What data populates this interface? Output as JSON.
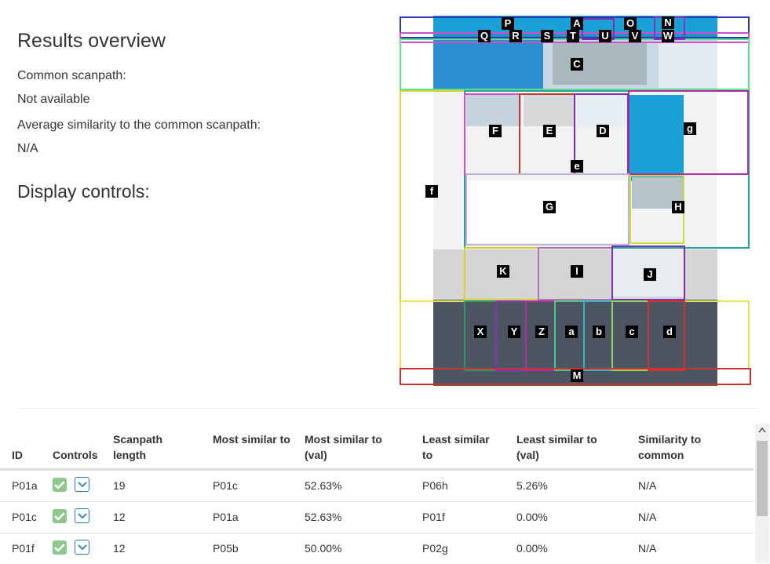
{
  "overview": {
    "title": "Results overview",
    "common_label": "Common scanpath:",
    "common_value": "Not available",
    "avg_label": "Average similarity to the common scanpath:",
    "avg_value": "N/A",
    "display_controls": "Display controls:"
  },
  "aoi_labels": [
    "P",
    "A",
    "O",
    "N",
    "Q",
    "R",
    "S",
    "T",
    "U",
    "V",
    "W",
    "C",
    "F",
    "E",
    "D",
    "g",
    "e",
    "f",
    "G",
    "H",
    "K",
    "I",
    "J",
    "X",
    "Y",
    "Z",
    "a",
    "b",
    "c",
    "d",
    "M"
  ],
  "table": {
    "headers": [
      "ID",
      "Controls",
      "Scanpath length",
      "Most similar to",
      "Most similar to (val)",
      "Least similar to",
      "Least similar to (val)",
      "Similarity to common"
    ],
    "rows": [
      {
        "id": "P01a",
        "length": "19",
        "most": "P01c",
        "most_val": "52.63%",
        "least": "P06h",
        "least_val": "5.26%",
        "common": "N/A"
      },
      {
        "id": "P01c",
        "length": "12",
        "most": "P01a",
        "most_val": "52.63%",
        "least": "P01f",
        "least_val": "0.00%",
        "common": "N/A"
      },
      {
        "id": "P01f",
        "length": "12",
        "most": "P05b",
        "most_val": "50.00%",
        "least": "P02g",
        "least_val": "0.00%",
        "common": "N/A"
      }
    ]
  },
  "colors": {
    "accent": "#2a7ab7",
    "check": "#8dc78d"
  }
}
